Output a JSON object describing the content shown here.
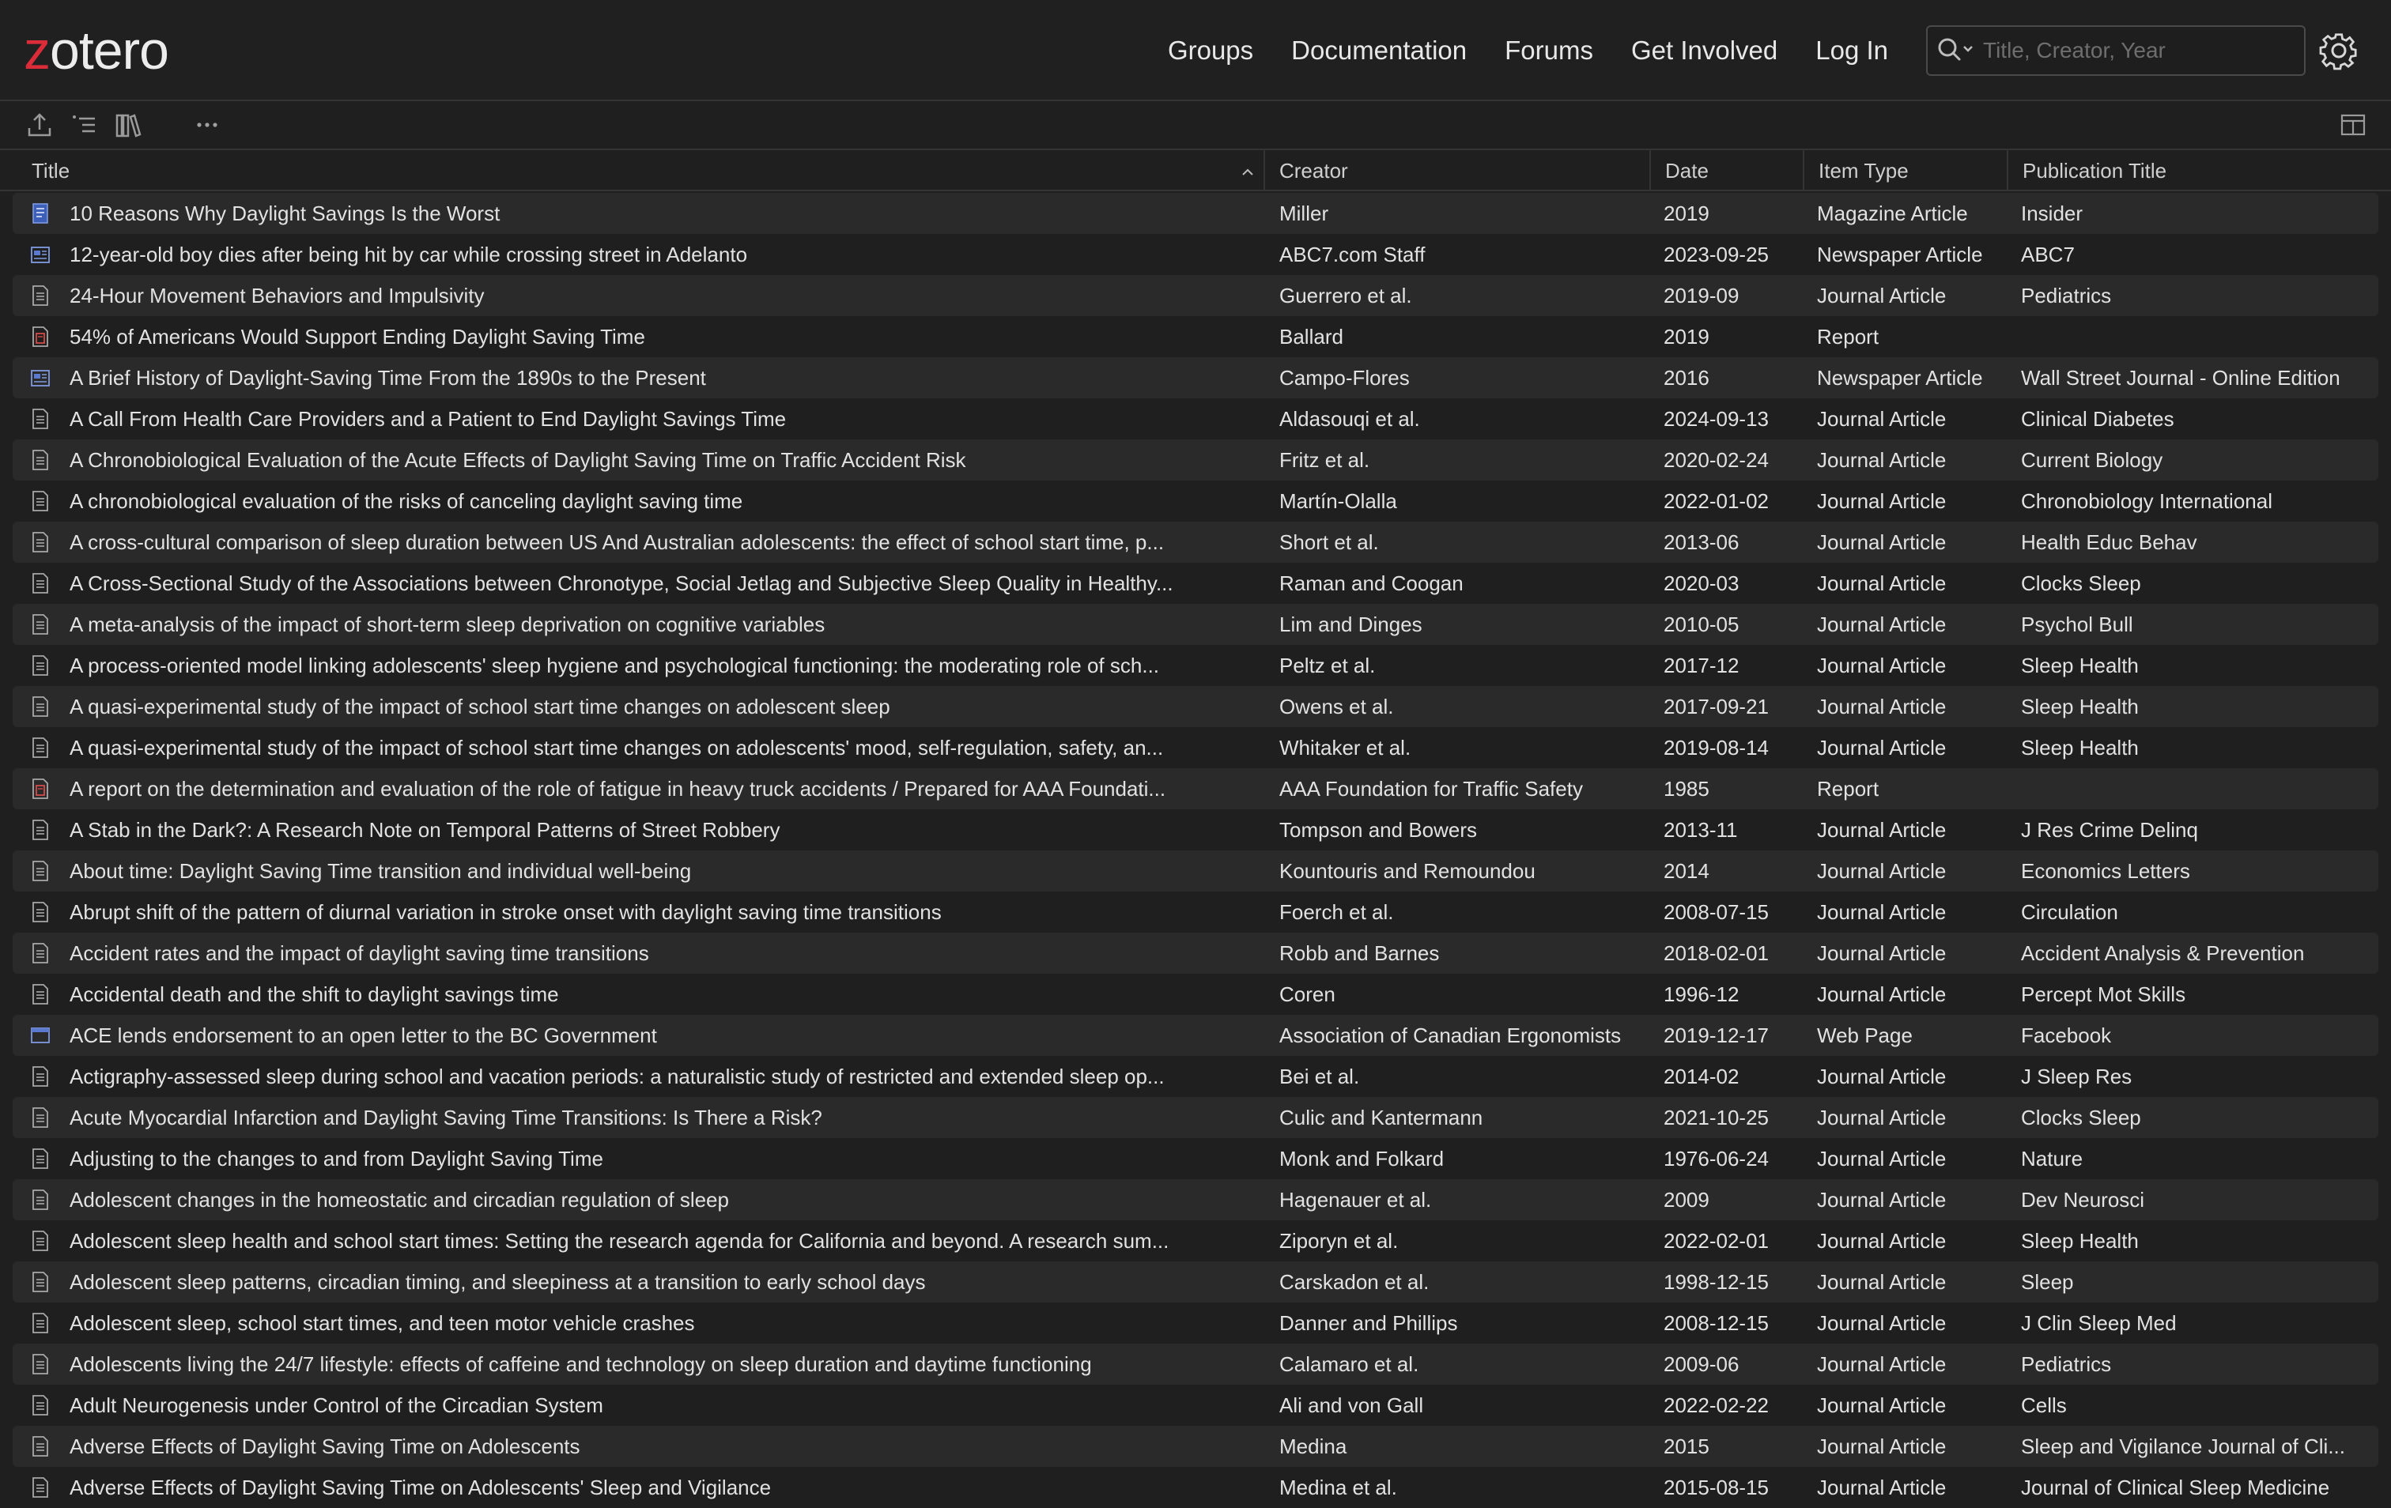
{
  "brand": {
    "logo_first": "z",
    "logo_rest": "otero"
  },
  "nav": [
    "Groups",
    "Documentation",
    "Forums",
    "Get Involved",
    "Log In"
  ],
  "search": {
    "placeholder": "Title, Creator, Year"
  },
  "columns": [
    "Title",
    "Creator",
    "Date",
    "Item Type",
    "Publication Title"
  ],
  "colors": {
    "logo_accent": "#db2c3a",
    "row_alt": "#2a2a2a",
    "background": "#1f1f1f"
  },
  "rows": [
    {
      "icon": "magazine-icon",
      "title": "10 Reasons Why Daylight Savings Is the Worst",
      "creator": "Miller",
      "date": "2019",
      "type": "Magazine Article",
      "pub": "Insider"
    },
    {
      "icon": "newspaper-icon",
      "title": "12-year-old boy dies after being hit by car while crossing street in Adelanto",
      "creator": "ABC7.com Staff",
      "date": "2023-09-25",
      "type": "Newspaper Article",
      "pub": "ABC7"
    },
    {
      "icon": "journal-article-icon",
      "title": "24-Hour Movement Behaviors and Impulsivity",
      "creator": "Guerrero et al.",
      "date": "2019-09",
      "type": "Journal Article",
      "pub": "Pediatrics"
    },
    {
      "icon": "report-icon",
      "title": "54% of Americans Would Support Ending Daylight Saving Time",
      "creator": "Ballard",
      "date": "2019",
      "type": "Report",
      "pub": ""
    },
    {
      "icon": "newspaper-icon",
      "title": "A Brief History of Daylight-Saving Time From the 1890s to the Present",
      "creator": "Campo-Flores",
      "date": "2016",
      "type": "Newspaper Article",
      "pub": "Wall Street Journal - Online Edition"
    },
    {
      "icon": "journal-article-icon",
      "title": "A Call From Health Care Providers and a Patient to End Daylight Savings Time",
      "creator": "Aldasouqi et al.",
      "date": "2024-09-13",
      "type": "Journal Article",
      "pub": "Clinical Diabetes"
    },
    {
      "icon": "journal-article-icon",
      "title": "A Chronobiological Evaluation of the Acute Effects of Daylight Saving Time on Traffic Accident Risk",
      "creator": "Fritz et al.",
      "date": "2020-02-24",
      "type": "Journal Article",
      "pub": "Current Biology"
    },
    {
      "icon": "journal-article-icon",
      "title": "A chronobiological evaluation of the risks of canceling daylight saving time",
      "creator": "Martín-Olalla",
      "date": "2022-01-02",
      "type": "Journal Article",
      "pub": "Chronobiology International"
    },
    {
      "icon": "journal-article-icon",
      "title": "A cross-cultural comparison of sleep duration between US And Australian adolescents: the effect of school start time, p...",
      "creator": "Short et al.",
      "date": "2013-06",
      "type": "Journal Article",
      "pub": "Health Educ Behav"
    },
    {
      "icon": "journal-article-icon",
      "title": "A Cross-Sectional Study of the Associations between Chronotype, Social Jetlag and Subjective Sleep Quality in Healthy...",
      "creator": "Raman and Coogan",
      "date": "2020-03",
      "type": "Journal Article",
      "pub": "Clocks Sleep"
    },
    {
      "icon": "journal-article-icon",
      "title": "A meta-analysis of the impact of short-term sleep deprivation on cognitive variables",
      "creator": "Lim and Dinges",
      "date": "2010-05",
      "type": "Journal Article",
      "pub": "Psychol Bull"
    },
    {
      "icon": "journal-article-icon",
      "title": "A process-oriented model linking adolescents' sleep hygiene and psychological functioning: the moderating role of sch...",
      "creator": "Peltz et al.",
      "date": "2017-12",
      "type": "Journal Article",
      "pub": "Sleep Health"
    },
    {
      "icon": "journal-article-icon",
      "title": "A quasi-experimental study of the impact of school start time changes on adolescent sleep",
      "creator": "Owens et al.",
      "date": "2017-09-21",
      "type": "Journal Article",
      "pub": "Sleep Health"
    },
    {
      "icon": "journal-article-icon",
      "title": "A quasi-experimental study of the impact of school start time changes on adolescents' mood, self-regulation, safety, an...",
      "creator": "Whitaker et al.",
      "date": "2019-08-14",
      "type": "Journal Article",
      "pub": "Sleep Health"
    },
    {
      "icon": "report-icon",
      "title": "A report on the determination and evaluation of the role of fatigue in heavy truck accidents / Prepared for AAA Foundati...",
      "creator": "AAA Foundation for Traffic Safety",
      "date": "1985",
      "type": "Report",
      "pub": ""
    },
    {
      "icon": "journal-article-icon",
      "title": "A Stab in the Dark?: A Research Note on Temporal Patterns of Street Robbery",
      "creator": "Tompson and Bowers",
      "date": "2013-11",
      "type": "Journal Article",
      "pub": "J Res Crime Delinq"
    },
    {
      "icon": "journal-article-icon",
      "title": "About time: Daylight Saving Time transition and individual well-being",
      "creator": "Kountouris and Remoundou",
      "date": "2014",
      "type": "Journal Article",
      "pub": "Economics Letters"
    },
    {
      "icon": "journal-article-icon",
      "title": "Abrupt shift of the pattern of diurnal variation in stroke onset with daylight saving time transitions",
      "creator": "Foerch et al.",
      "date": "2008-07-15",
      "type": "Journal Article",
      "pub": "Circulation"
    },
    {
      "icon": "journal-article-icon",
      "title": "Accident rates and the impact of daylight saving time transitions",
      "creator": "Robb and Barnes",
      "date": "2018-02-01",
      "type": "Journal Article",
      "pub": "Accident Analysis & Prevention"
    },
    {
      "icon": "journal-article-icon",
      "title": "Accidental death and the shift to daylight savings time",
      "creator": "Coren",
      "date": "1996-12",
      "type": "Journal Article",
      "pub": "Percept Mot Skills"
    },
    {
      "icon": "web-page-icon",
      "title": "ACE lends endorsement to an open letter to the BC Government",
      "creator": "Association of Canadian Ergonomists",
      "date": "2019-12-17",
      "type": "Web Page",
      "pub": "Facebook"
    },
    {
      "icon": "journal-article-icon",
      "title": "Actigraphy-assessed sleep during school and vacation periods: a naturalistic study of restricted and extended sleep op...",
      "creator": "Bei et al.",
      "date": "2014-02",
      "type": "Journal Article",
      "pub": "J Sleep Res"
    },
    {
      "icon": "journal-article-icon",
      "title": "Acute Myocardial Infarction and Daylight Saving Time Transitions: Is There a Risk?",
      "creator": "Culic and Kantermann",
      "date": "2021-10-25",
      "type": "Journal Article",
      "pub": "Clocks Sleep"
    },
    {
      "icon": "journal-article-icon",
      "title": "Adjusting to the changes to and from Daylight Saving Time",
      "creator": "Monk and Folkard",
      "date": "1976-06-24",
      "type": "Journal Article",
      "pub": "Nature"
    },
    {
      "icon": "journal-article-icon",
      "title": "Adolescent changes in the homeostatic and circadian regulation of sleep",
      "creator": "Hagenauer et al.",
      "date": "2009",
      "type": "Journal Article",
      "pub": "Dev Neurosci"
    },
    {
      "icon": "journal-article-icon",
      "title": "Adolescent sleep health and school start times: Setting the research agenda for California and beyond. A research sum...",
      "creator": "Ziporyn et al.",
      "date": "2022-02-01",
      "type": "Journal Article",
      "pub": "Sleep Health"
    },
    {
      "icon": "journal-article-icon",
      "title": "Adolescent sleep patterns, circadian timing, and sleepiness at a transition to early school days",
      "creator": "Carskadon et al.",
      "date": "1998-12-15",
      "type": "Journal Article",
      "pub": "Sleep"
    },
    {
      "icon": "journal-article-icon",
      "title": "Adolescent sleep, school start times, and teen motor vehicle crashes",
      "creator": "Danner and Phillips",
      "date": "2008-12-15",
      "type": "Journal Article",
      "pub": "J Clin Sleep Med"
    },
    {
      "icon": "journal-article-icon",
      "title": "Adolescents living the 24/7 lifestyle: effects of caffeine and technology on sleep duration and daytime functioning",
      "creator": "Calamaro et al.",
      "date": "2009-06",
      "type": "Journal Article",
      "pub": "Pediatrics"
    },
    {
      "icon": "journal-article-icon",
      "title": "Adult Neurogenesis under Control of the Circadian System",
      "creator": "Ali and von Gall",
      "date": "2022-02-22",
      "type": "Journal Article",
      "pub": "Cells"
    },
    {
      "icon": "journal-article-icon",
      "title": "Adverse Effects of Daylight Saving Time on Adolescents",
      "creator": "Medina",
      "date": "2015",
      "type": "Journal Article",
      "pub": "Sleep and Vigilance Journal of Cli..."
    },
    {
      "icon": "journal-article-icon",
      "title": "Adverse Effects of Daylight Saving Time on Adolescents' Sleep and Vigilance",
      "creator": "Medina et al.",
      "date": "2015-08-15",
      "type": "Journal Article",
      "pub": "Journal of Clinical Sleep Medicine"
    }
  ]
}
